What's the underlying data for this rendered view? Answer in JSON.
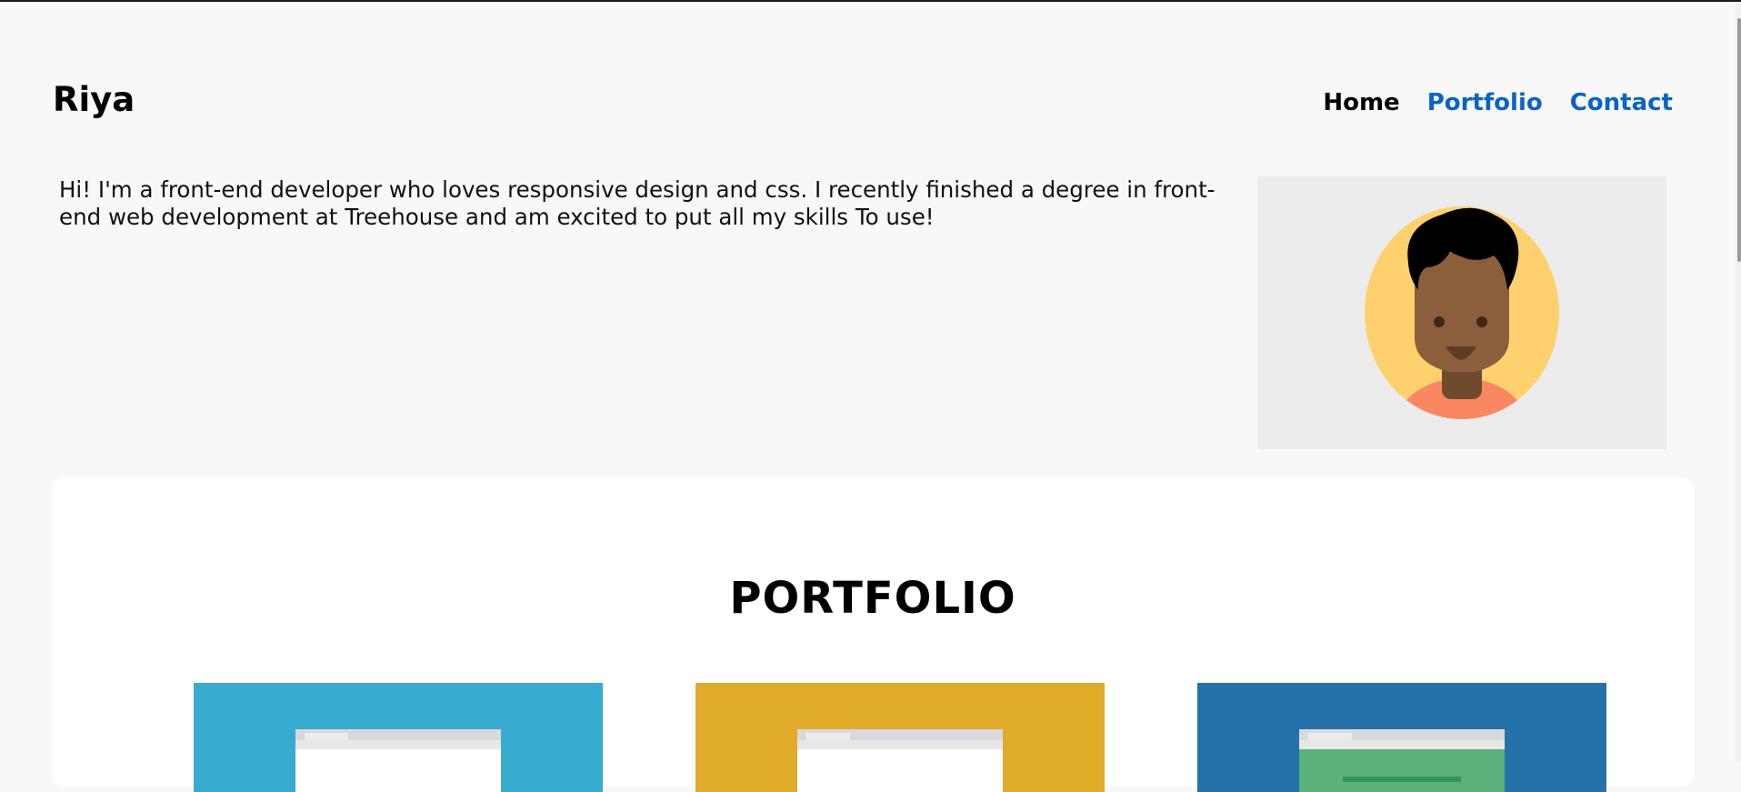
{
  "site": {
    "logo": "Riya"
  },
  "nav": {
    "items": [
      {
        "label": "Home",
        "active": true
      },
      {
        "label": "Portfolio",
        "active": false
      },
      {
        "label": "Contact",
        "active": false
      }
    ],
    "link_color": "#0b63c4",
    "active_color": "#000000"
  },
  "intro": {
    "text": "Hi! I'm a front-end developer who loves responsive design and css. I recently finished a degree in front-end web development at Treehouse and am excited to put all my skills To use!"
  },
  "avatar": {
    "icon": "avatar-icon",
    "background": "#ececec",
    "circle_color": "#fed16e",
    "skin_color": "#8b5e3c",
    "hair_color": "#000000",
    "shirt_color": "#f9875f"
  },
  "portfolio": {
    "title": "PORTFOLIO",
    "cards": [
      {
        "color": "#38abd1",
        "variant": "white"
      },
      {
        "color": "#e0ab29",
        "variant": "white"
      },
      {
        "color": "#2572ab",
        "variant": "green"
      }
    ]
  }
}
